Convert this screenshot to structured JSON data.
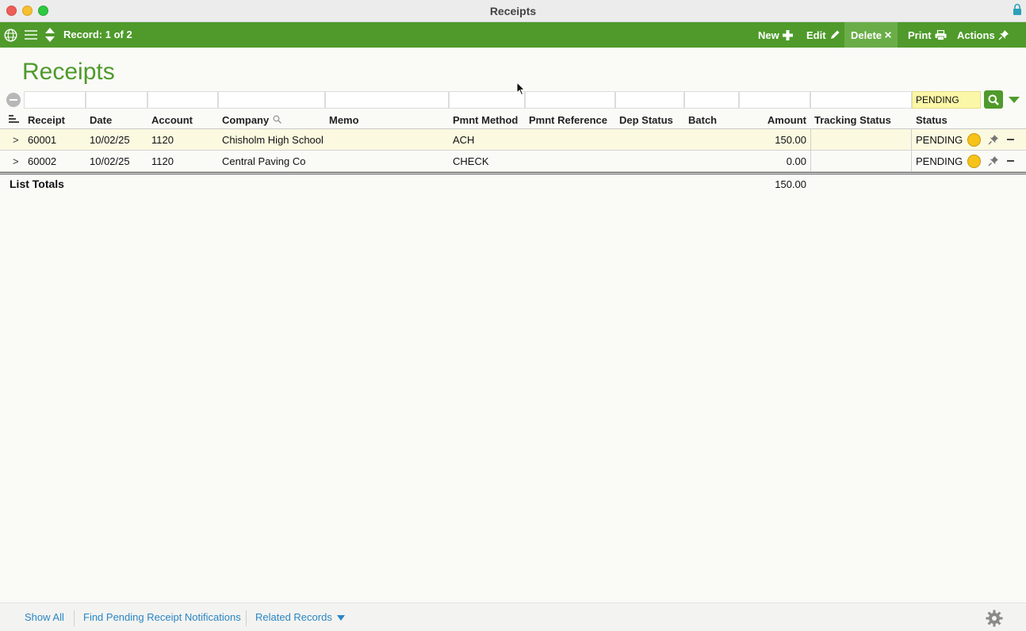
{
  "window": {
    "title": "Receipts"
  },
  "toolbar": {
    "record_label": "Record: 1 of 2",
    "buttons": [
      {
        "label": "New",
        "icon": "plus-icon"
      },
      {
        "label": "Edit",
        "icon": "pencil-icon"
      },
      {
        "label": "Delete",
        "icon": "x-icon"
      },
      {
        "label": "Print",
        "icon": "printer-icon"
      },
      {
        "label": "Actions",
        "icon": "pushpin-icon"
      }
    ]
  },
  "page": {
    "heading": "Receipts"
  },
  "filter": {
    "status_value": "PENDING"
  },
  "table": {
    "columns": [
      "Receipt",
      "Date",
      "Account",
      "Company",
      "Memo",
      "Pmnt Method",
      "Pmnt Reference",
      "Dep Status",
      "Batch",
      "Amount",
      "Tracking Status",
      "Status"
    ],
    "rows": [
      {
        "expander": ">",
        "receipt": "60001",
        "date": "10/02/25",
        "account": "1120",
        "company": "Chisholm High School",
        "memo": "",
        "pmnt_method": "ACH",
        "pmnt_reference": "",
        "dep_status": "",
        "batch": "",
        "amount": "150.00",
        "tracking_status": "",
        "status": "PENDING"
      },
      {
        "expander": ">",
        "receipt": "60002",
        "date": "10/02/25",
        "account": "1120",
        "company": "Central Paving Co",
        "memo": "",
        "pmnt_method": "CHECK",
        "pmnt_reference": "",
        "dep_status": "",
        "batch": "",
        "amount": "0.00",
        "tracking_status": "",
        "status": "PENDING"
      }
    ],
    "totals": {
      "label": "List Totals",
      "amount": "150.00"
    }
  },
  "footer": {
    "links": [
      "Show All",
      "Find Pending Receipt Notifications",
      "Related Records"
    ]
  },
  "colors": {
    "toolbar_green": "#4f9a2b",
    "heading_green": "#4f9a2b",
    "status_pending_dot": "#f7c318",
    "link_blue": "#2a86c4",
    "filter_highlight": "#fbf7a8"
  }
}
